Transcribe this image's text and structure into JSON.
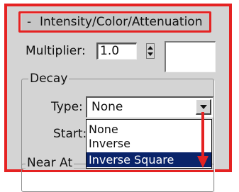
{
  "rollout": {
    "collapse_symbol": "-",
    "title": "Intensity/Color/Attenuation"
  },
  "multiplier": {
    "label": "Multiplier:",
    "value": "1.0",
    "color_swatch": "#ffffff"
  },
  "decay": {
    "group_label": "Decay",
    "type_label": "Type:",
    "type_value": "None",
    "start_label": "Start:",
    "options": [
      "None",
      "Inverse",
      "Inverse Square"
    ],
    "selected_option": "Inverse Square"
  },
  "near_attenuation": {
    "group_label": "Near At"
  },
  "colors": {
    "highlight_border": "#e52222",
    "selection": "#0a246a",
    "arrow": "#e52222",
    "panel": "#d4d4d4"
  }
}
